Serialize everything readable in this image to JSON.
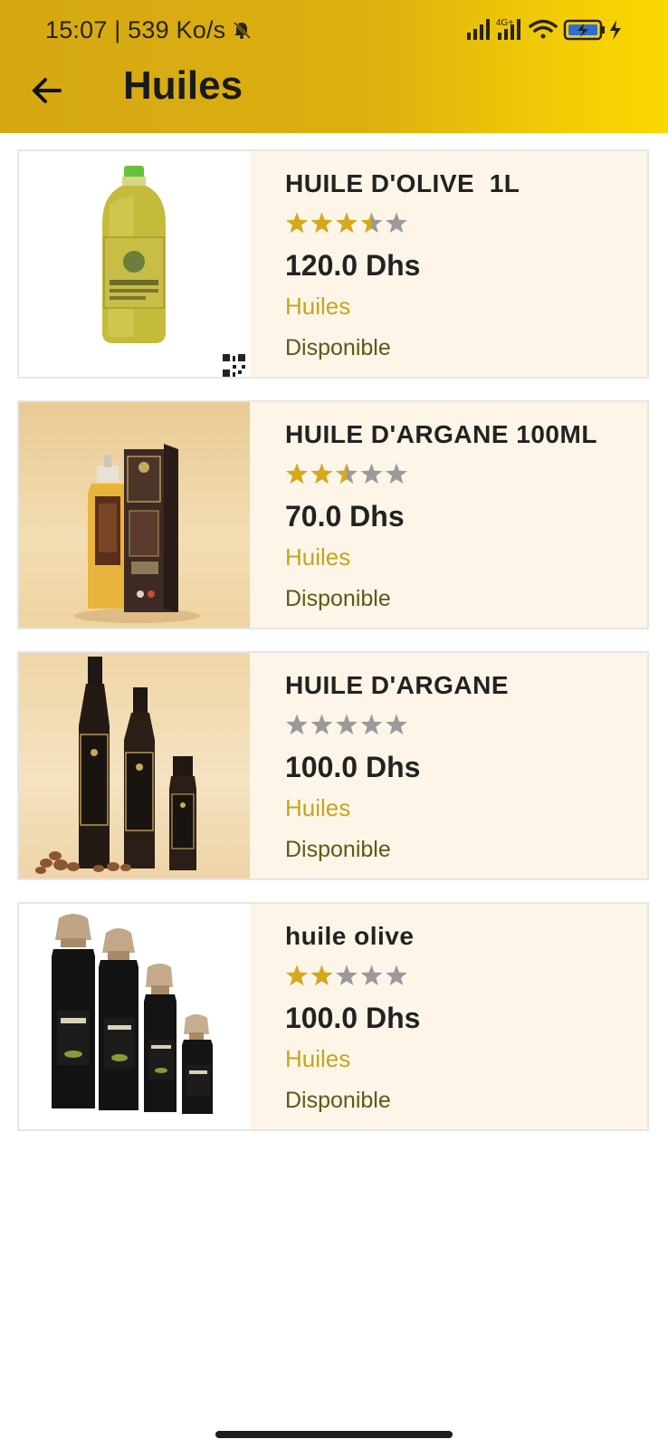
{
  "status_bar": {
    "time": "15:07 | 539 Ko/s",
    "network_label": "4G+",
    "icons": [
      "mute-bell-icon",
      "signal-icon",
      "signal-4g-icon",
      "wifi-icon",
      "battery-charging-icon"
    ]
  },
  "header": {
    "back_icon": "arrow-left-icon",
    "title": "Huiles"
  },
  "products": [
    {
      "name": "HUILE D'OLIVE  1L",
      "rating": 3.5,
      "rating_max": 5,
      "price": "120.0 Dhs",
      "category": "Huiles",
      "availability": "Disponible",
      "image": "olive-oil-bottle-1l"
    },
    {
      "name": "HUILE D'ARGANE 100ML",
      "rating": 2.5,
      "rating_max": 5,
      "price": "70.0 Dhs",
      "category": "Huiles",
      "availability": "Disponible",
      "image": "argan-oil-bottle-box"
    },
    {
      "name": "HUILE D'ARGANE",
      "rating": 0,
      "rating_max": 5,
      "price": "100.0 Dhs",
      "category": "Huiles",
      "availability": "Disponible",
      "image": "argan-oil-three-bottles"
    },
    {
      "name": "huile olive",
      "rating": 2,
      "rating_max": 5,
      "price": "100.0 Dhs",
      "category": "Huiles",
      "availability": "Disponible",
      "image": "olive-oil-four-bottles"
    }
  ],
  "colors": {
    "appbar_start": "#d5a813",
    "appbar_end": "#fbd700",
    "star_filled": "#d6a91a",
    "star_empty": "#9a9a9a",
    "category_text": "#c7a41c",
    "availability_text": "#5b5a17",
    "card_background": "#fdf6e8"
  }
}
